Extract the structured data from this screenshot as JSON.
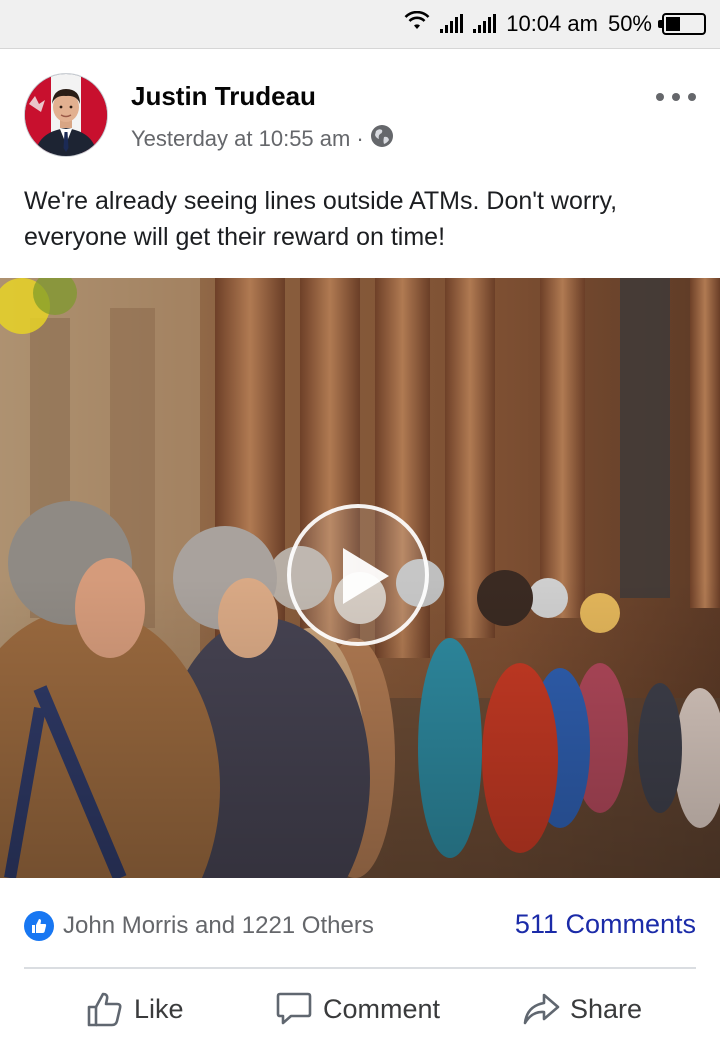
{
  "status_bar": {
    "time": "10:04 am",
    "battery": "50%",
    "icons": [
      "wifi-icon",
      "signal-icon",
      "signal-icon",
      "battery-icon"
    ]
  },
  "post": {
    "author": "Justin Trudeau",
    "timestamp": "Yesterday at 10:55 am",
    "separator": "·",
    "privacy_icon": "globe-icon",
    "more_icon": "more-options-icon",
    "text": "We're already seeing lines outside ATMs. Don't worry, everyone will get their reward on time!",
    "media": {
      "type": "video",
      "play_icon": "play-icon"
    }
  },
  "reactions": {
    "icon": "like-reaction-icon",
    "summary": "John Morris and 1221 Others",
    "comments": "511 Comments"
  },
  "actions": [
    {
      "label": "Like",
      "icon": "thumbs-up-icon"
    },
    {
      "label": "Comment",
      "icon": "comment-icon"
    },
    {
      "label": "Share",
      "icon": "share-icon"
    }
  ],
  "colors": {
    "link_blue": "#1b2ba8",
    "fb_blue": "#1877f2",
    "secondary_text": "#65676b"
  }
}
